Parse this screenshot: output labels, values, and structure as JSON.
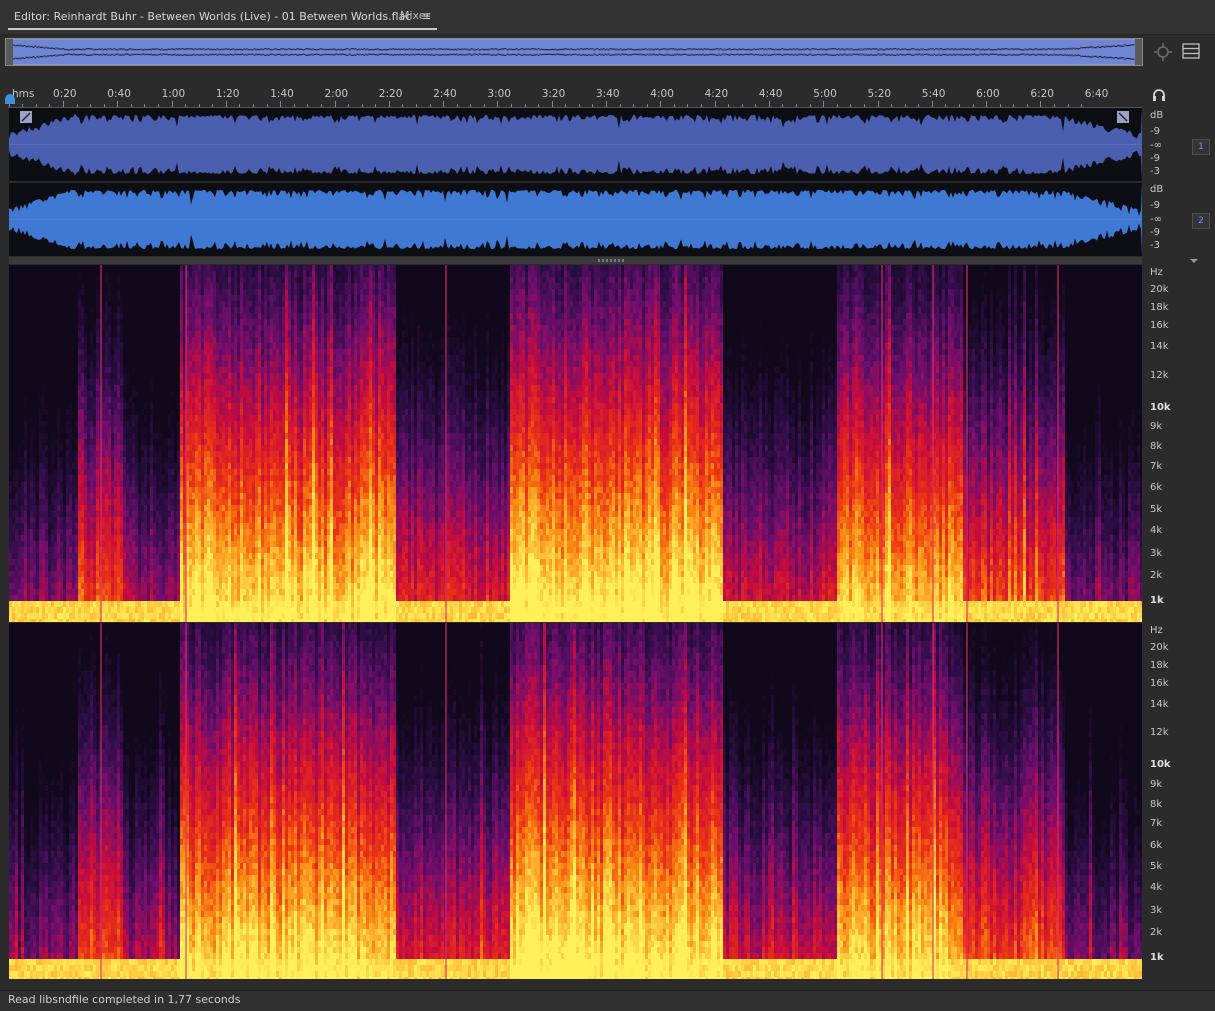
{
  "tabs": {
    "editor_label": "Editor: Reinhardt Buhr - Between Worlds (Live) - 01 Between Worlds.flac",
    "editor_menu_glyph": "≡",
    "mixer_label": "Mixer"
  },
  "timeline": {
    "unit_label": "hms",
    "ticks": [
      "0:20",
      "0:40",
      "1:00",
      "1:20",
      "1:40",
      "2:00",
      "2:20",
      "2:40",
      "3:00",
      "3:20",
      "3:40",
      "4:00",
      "4:20",
      "4:40",
      "5:00",
      "5:20",
      "5:40",
      "6:00",
      "6:20",
      "6:40"
    ]
  },
  "channels": [
    {
      "badge": "1",
      "db_labels": [
        "dB",
        "-9",
        "-∞",
        "-9",
        "-3"
      ]
    },
    {
      "badge": "2",
      "db_labels": [
        "dB",
        "-9",
        "-∞",
        "-9",
        "-3"
      ]
    }
  ],
  "spectrogram_scale": {
    "unit": "Hz",
    "labels": [
      "20k",
      "18k",
      "16k",
      "14k",
      "12k",
      "10k",
      "9k",
      "8k",
      "7k",
      "6k",
      "5k",
      "4k",
      "3k",
      "2k",
      "1k"
    ]
  },
  "colors": {
    "waveform_ch1": "#4a5fb0",
    "waveform_ch2": "#3f79d4",
    "waveform_ink": "#0d0d14",
    "accent": "#3f8fdc"
  },
  "icons": {
    "zoom": "zoom-to-selection-icon",
    "panel_menu": "panel-menu-icon",
    "headphones": "headphones-icon",
    "collapse": "chevron-down-icon"
  },
  "status": {
    "message": "Read libsndfile completed in 1,77 seconds"
  }
}
